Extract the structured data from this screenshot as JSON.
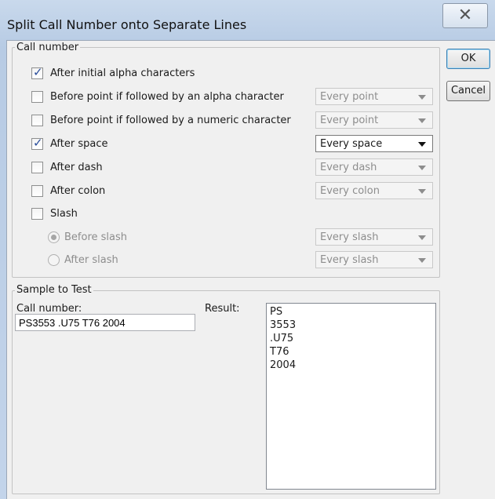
{
  "window": {
    "title": "Split Call Number onto Separate Lines",
    "close_glyph": "✕",
    "close_icon": "close-icon"
  },
  "buttons": {
    "ok": "OK",
    "cancel": "Cancel"
  },
  "call_number_group": {
    "legend": "Call number",
    "options": [
      {
        "label": "After initial alpha characters",
        "checked": true,
        "select": null
      },
      {
        "label": "Before point if followed by an alpha character",
        "checked": false,
        "select": "Every point"
      },
      {
        "label": "Before point if followed by a numeric character",
        "checked": false,
        "select": "Every point"
      },
      {
        "label": "After space",
        "checked": true,
        "select": "Every space"
      },
      {
        "label": "After dash",
        "checked": false,
        "select": "Every dash"
      },
      {
        "label": "After colon",
        "checked": false,
        "select": "Every colon"
      },
      {
        "label": "Slash",
        "checked": false,
        "select": null
      }
    ],
    "slash_options": [
      {
        "label": "Before slash",
        "selected": true,
        "select": "Every slash"
      },
      {
        "label": "After slash",
        "selected": false,
        "select": "Every slash"
      }
    ]
  },
  "sample_group": {
    "legend": "Sample to Test",
    "call_number_label": "Call number:",
    "call_number_value": "PS3553 .U75 T76 2004",
    "result_label": "Result:",
    "result_lines": [
      "PS",
      "3553",
      ".U75",
      "T76",
      "2004"
    ]
  },
  "colors": {
    "title_bg": "#c3d4ea",
    "dialog_bg": "#f0f0f0",
    "check_accent": "#2a4d9b"
  }
}
